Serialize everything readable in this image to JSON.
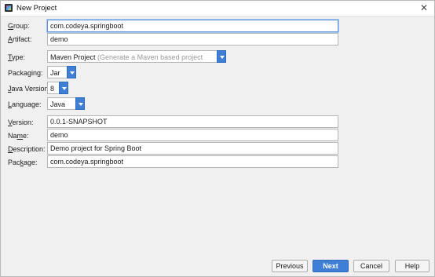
{
  "window": {
    "title": "New Project",
    "close_glyph": "✕"
  },
  "fields": {
    "group": {
      "mnemonic": "G",
      "label_rest": "roup:",
      "value": "com.codeya.springboot"
    },
    "artifact": {
      "mnemonic": "A",
      "label_rest": "rtifact:",
      "value": "demo"
    },
    "type": {
      "mnemonic": "T",
      "label_rest": "ype:",
      "value": "Maven Project",
      "hint": "(Generate a Maven based project archive)"
    },
    "packaging": {
      "label_pre": "Packaging:",
      "value": "Jar"
    },
    "java_version": {
      "mnemonic": "J",
      "label_rest": "ava Version:",
      "value": "8"
    },
    "language": {
      "mnemonic": "L",
      "label_rest": "anguage:",
      "value": "Java"
    },
    "version": {
      "mnemonic": "V",
      "label_rest": "ersion:",
      "value": "0.0.1-SNAPSHOT"
    },
    "name": {
      "label_pre": "Na",
      "mnemonic": "m",
      "label_rest": "e:",
      "value": "demo"
    },
    "description": {
      "mnemonic": "D",
      "label_rest": "escription:",
      "value": "Demo project for Spring Boot"
    },
    "package": {
      "label_pre": "Pac",
      "mnemonic": "k",
      "label_rest": "age:",
      "value": "com.codeya.springboot"
    }
  },
  "buttons": {
    "previous": "Previous",
    "next": "Next",
    "cancel": "Cancel",
    "help": "Help"
  },
  "colors": {
    "accent": "#3f7fd5",
    "focus_border": "#5b93d8"
  },
  "icons": {
    "app": "intellij-app-icon",
    "close": "close-icon",
    "dropdown": "chevron-down-icon"
  }
}
